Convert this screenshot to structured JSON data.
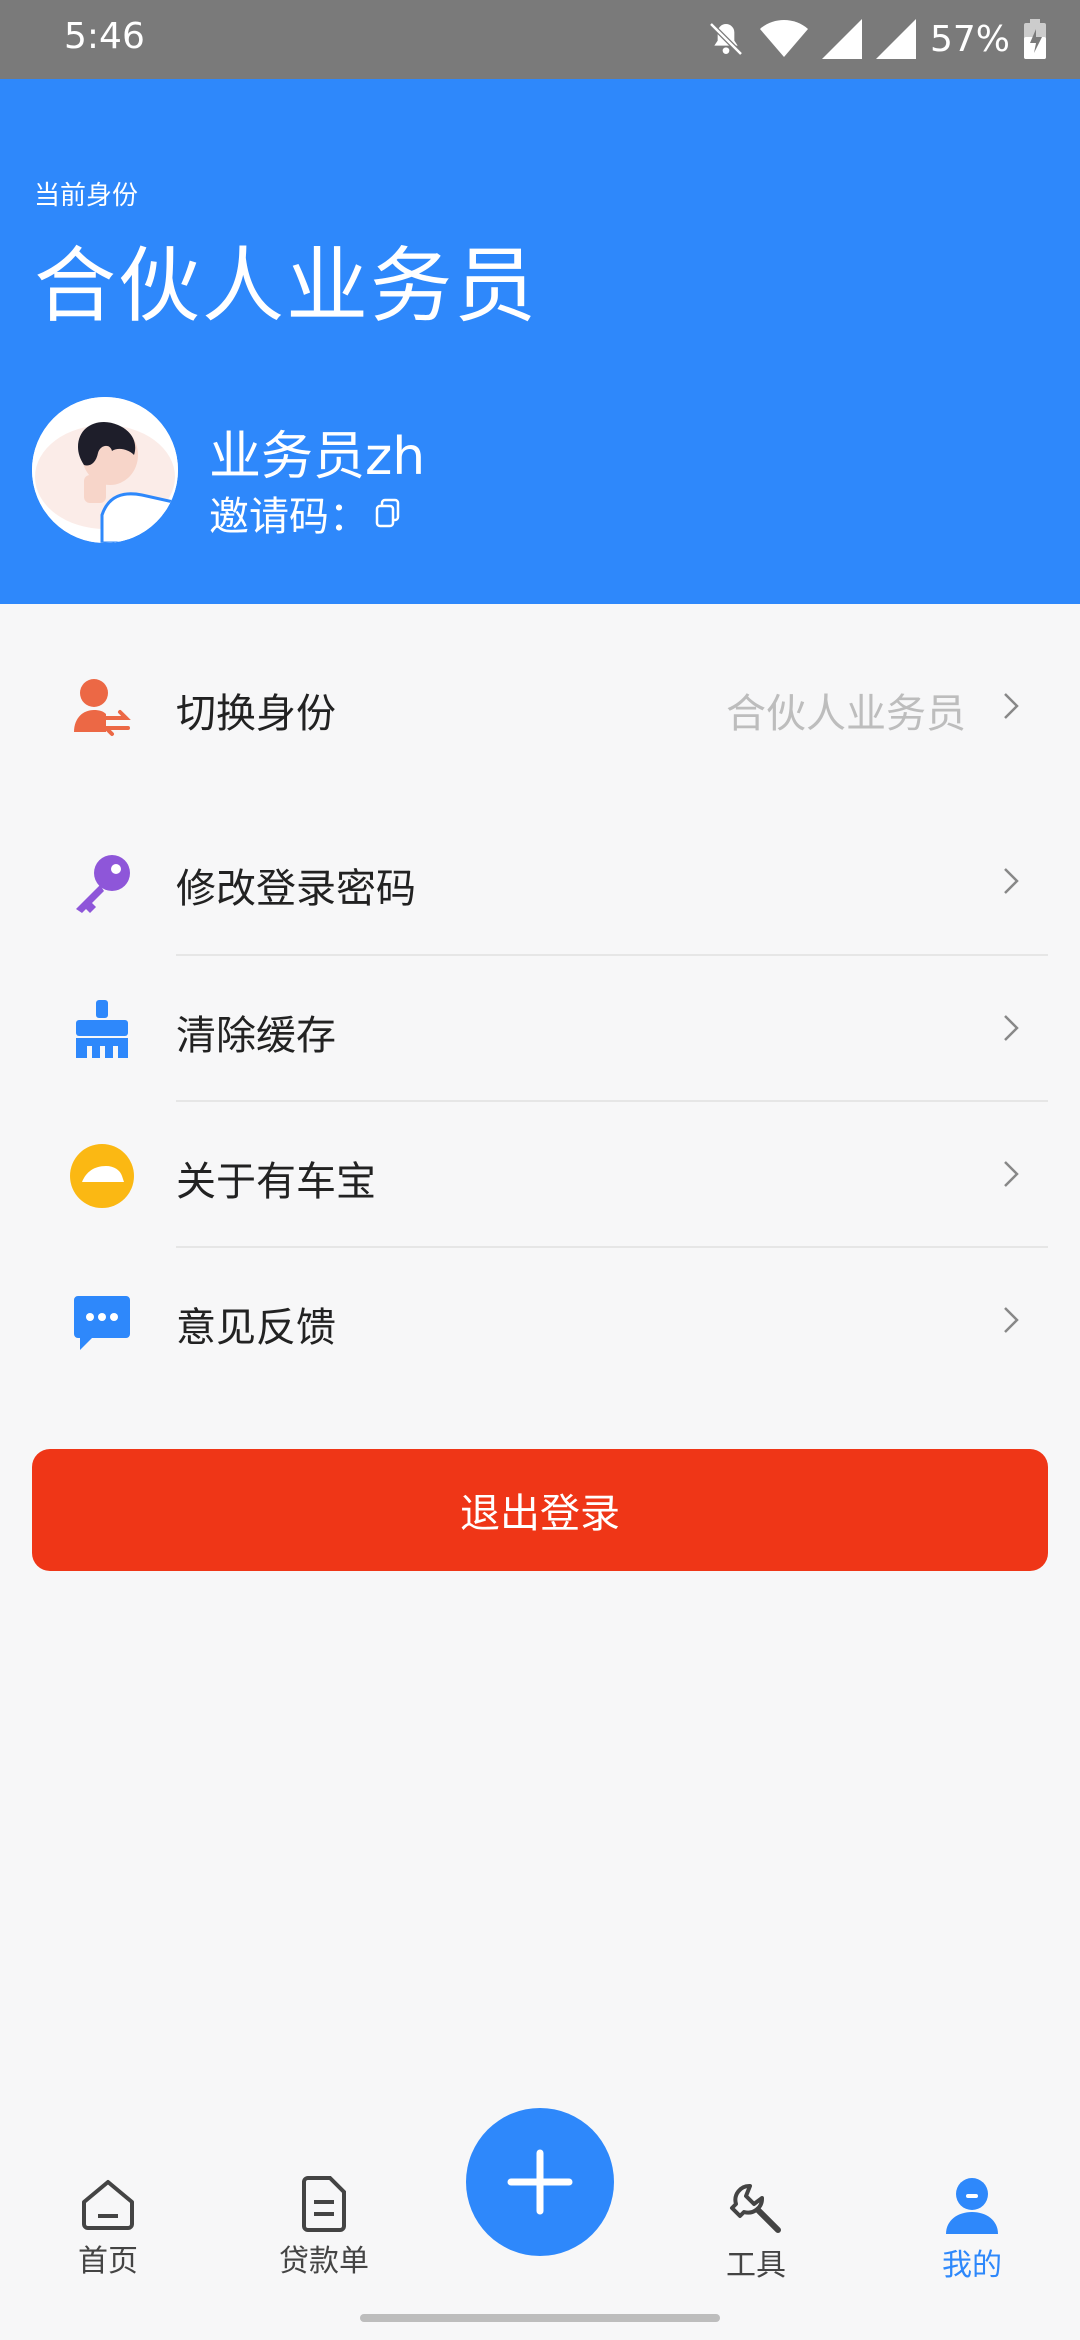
{
  "status_bar": {
    "time": "5:46",
    "battery": "57%"
  },
  "header": {
    "caption": "当前身份",
    "role": "合伙人业务员",
    "user_name": "业务员zh",
    "invite_label": "邀请码："
  },
  "menu": [
    {
      "label": "切换身份",
      "value": "合伙人业务员",
      "icon": "switch-identity-icon"
    },
    {
      "label": "修改登录密码",
      "value": "",
      "icon": "key-icon"
    },
    {
      "label": "清除缓存",
      "value": "",
      "icon": "broom-icon"
    },
    {
      "label": "关于有车宝",
      "value": "",
      "icon": "about-car-icon"
    },
    {
      "label": "意见反馈",
      "value": "",
      "icon": "feedback-icon"
    }
  ],
  "logout_label": "退出登录",
  "nav": {
    "home": "首页",
    "loans": "贷款单",
    "tools": "工具",
    "mine": "我的"
  },
  "colors": {
    "primary": "#2e88fb",
    "danger": "#ef3617"
  }
}
